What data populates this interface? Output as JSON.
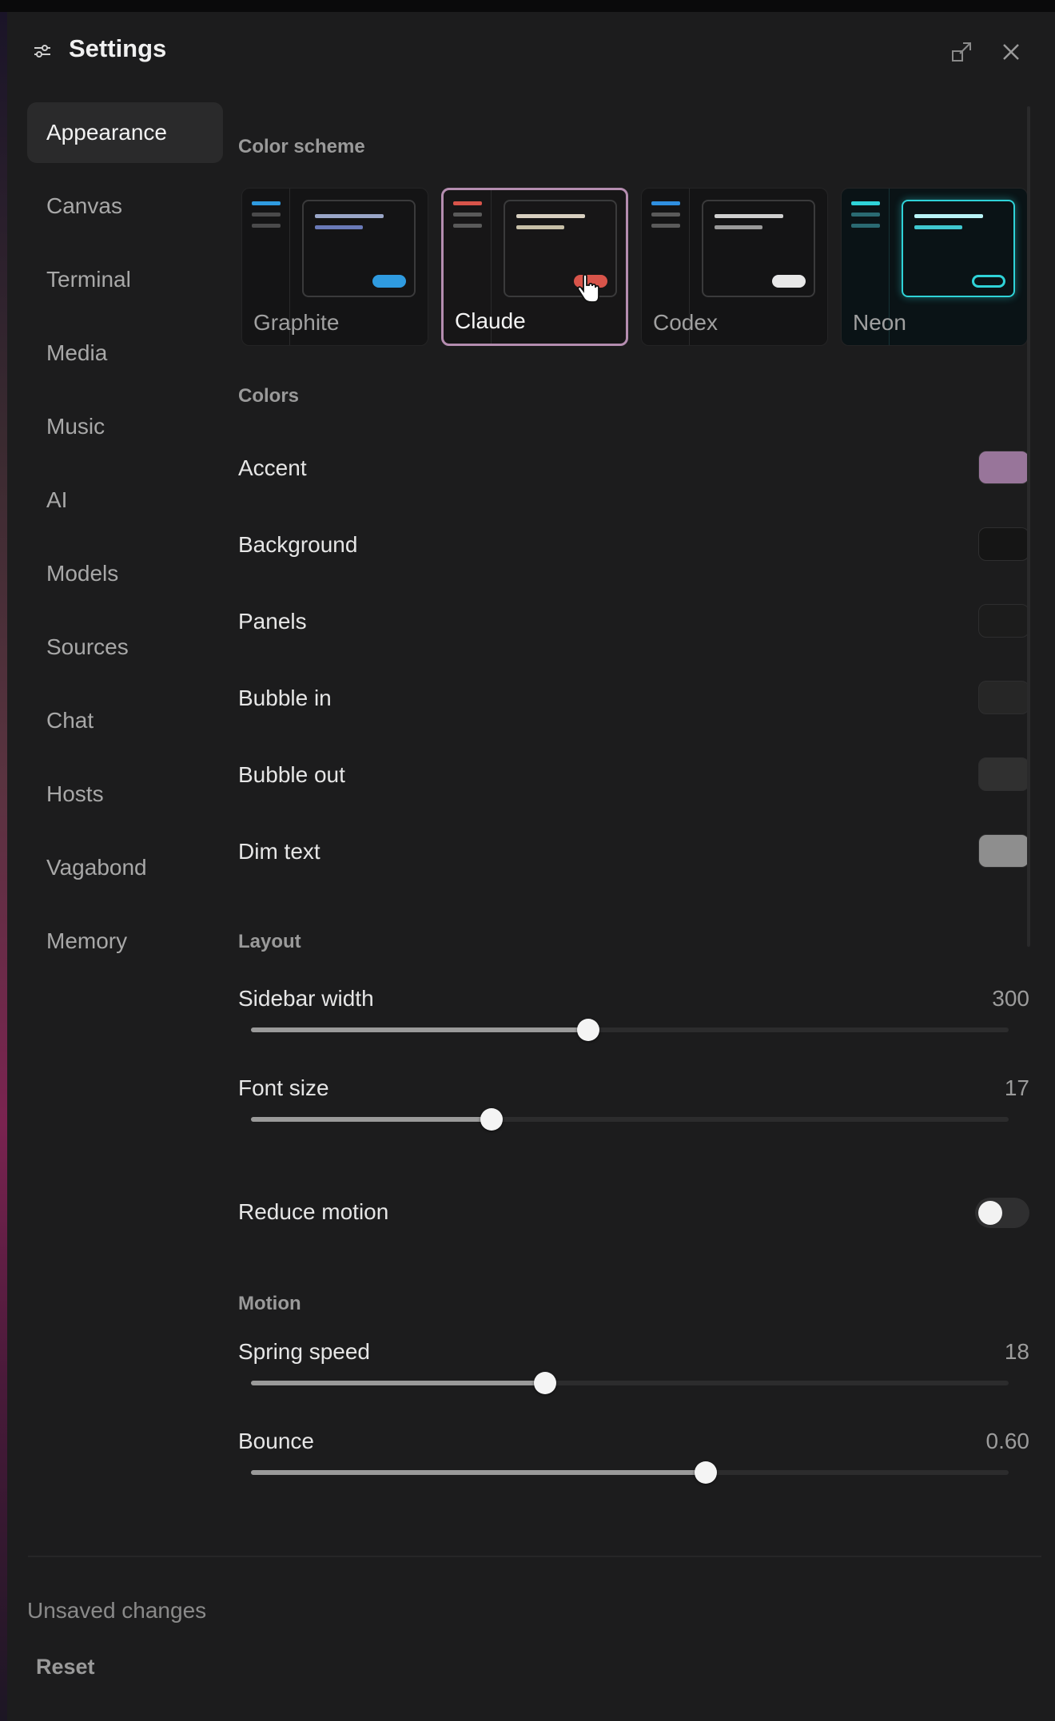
{
  "header": {
    "title": "Settings"
  },
  "sidebar": {
    "items": [
      {
        "label": "Appearance",
        "active": true
      },
      {
        "label": "Canvas"
      },
      {
        "label": "Terminal"
      },
      {
        "label": "Media"
      },
      {
        "label": "Music"
      },
      {
        "label": "AI"
      },
      {
        "label": "Models"
      },
      {
        "label": "Sources"
      },
      {
        "label": "Chat"
      },
      {
        "label": "Hosts"
      },
      {
        "label": "Vagabond"
      },
      {
        "label": "Memory"
      }
    ]
  },
  "color_scheme": {
    "title": "Color scheme",
    "selected": "Claude",
    "schemes": [
      {
        "name": "Graphite",
        "accent": "#2f9be0"
      },
      {
        "name": "Claude",
        "accent": "#d8544a"
      },
      {
        "name": "Codex",
        "accent": "#2f8fe0"
      },
      {
        "name": "Neon",
        "accent": "#2fd3d8"
      }
    ]
  },
  "colors": {
    "title": "Colors",
    "items": [
      {
        "label": "Accent",
        "color": "#98759a"
      },
      {
        "label": "Background",
        "color": "#151515"
      },
      {
        "label": "Panels",
        "color": "#1c1c1c"
      },
      {
        "label": "Bubble in",
        "color": "#262626"
      },
      {
        "label": "Bubble out",
        "color": "#303030"
      },
      {
        "label": "Dim text",
        "color": "#8e8e8e"
      }
    ]
  },
  "layout": {
    "title": "Layout",
    "sidebar_width": {
      "label": "Sidebar width",
      "value": "300",
      "fraction": 0.445
    },
    "font_size": {
      "label": "Font size",
      "value": "17",
      "fraction": 0.318
    },
    "reduce_motion": {
      "label": "Reduce motion",
      "on": false
    }
  },
  "motion": {
    "title": "Motion",
    "spring_speed": {
      "label": "Spring speed",
      "value": "18",
      "fraction": 0.388
    },
    "bounce": {
      "label": "Bounce",
      "value": "0.60",
      "fraction": 0.6
    }
  },
  "footer": {
    "status": "Unsaved changes",
    "reset_label": "Reset"
  }
}
